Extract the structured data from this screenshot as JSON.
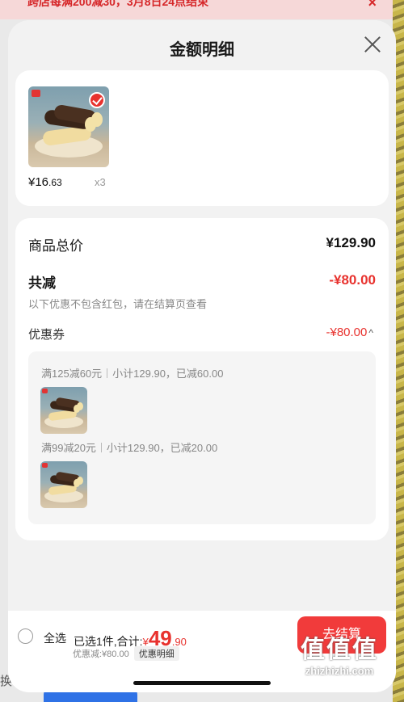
{
  "background": {
    "banner_text": "跨店每满200减30，3月8日24点结束",
    "banner_close": "×",
    "left_text": "换行"
  },
  "sheet": {
    "title": "金额明细",
    "close_icon": "close-icon"
  },
  "product": {
    "price_int": "¥16",
    "price_dec": ".63",
    "quantity": "x3",
    "selected": true
  },
  "summary": {
    "total_label": "商品总价",
    "total_value": "¥129.90",
    "reduce_label": "共减",
    "reduce_value": "-¥80.00",
    "note": "以下优惠不包含红包，请在结算页查看",
    "coupon_label": "优惠券",
    "coupon_value": "-¥80.00",
    "coupon_caret": "^"
  },
  "coupons": [
    {
      "rule": "满125减60元",
      "detail": "小计129.90，已减60.00"
    },
    {
      "rule": "满99减20元",
      "detail": "小计129.90，已减20.00"
    }
  ],
  "bottom": {
    "select_all": "全选",
    "selected_text": "已选1件,合计:",
    "currency": "¥",
    "total_int": "49",
    "total_dec": ".90",
    "discount_text": "优惠减:¥80.00",
    "detail_button": "优惠明细",
    "checkout_button": "去结算"
  },
  "watermark": {
    "main": "值值值",
    "sub": "zhizhizhi.com"
  },
  "colors": {
    "accent_red": "#e8322e",
    "checkout_red": "#f13b3b"
  }
}
